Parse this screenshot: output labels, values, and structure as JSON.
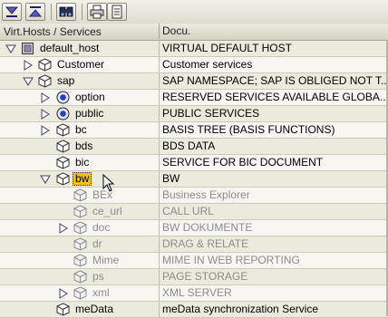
{
  "header": {
    "col1": "Virt.Hosts / Services",
    "col2": "Docu."
  },
  "rows": [
    {
      "name": "default_host",
      "docu": "VIRTUAL DEFAULT HOST"
    },
    {
      "name": "Customer",
      "docu": "Customer services"
    },
    {
      "name": "sap",
      "docu": "SAP NAMESPACE; SAP IS OBLIGED NOT T..."
    },
    {
      "name": "option",
      "docu": "RESERVED SERVICES AVAILABLE GLOBA..."
    },
    {
      "name": "public",
      "docu": "PUBLIC SERVICES"
    },
    {
      "name": "bc",
      "docu": "BASIS TREE (BASIS FUNCTIONS)"
    },
    {
      "name": "bds",
      "docu": "BDS DATA"
    },
    {
      "name": "bic",
      "docu": "SERVICE FOR BIC DOCUMENT"
    },
    {
      "name": "bw",
      "docu": "BW"
    },
    {
      "name": "BEx",
      "docu": "Business Explorer"
    },
    {
      "name": "ce_url",
      "docu": "CALL URL"
    },
    {
      "name": "doc",
      "docu": "BW DOKUMENTE"
    },
    {
      "name": "dr",
      "docu": "DRAG & RELATE"
    },
    {
      "name": "Mime",
      "docu": "MIME IN WEB REPORTING"
    },
    {
      "name": "ps",
      "docu": "PAGE STORAGE"
    },
    {
      "name": "xml",
      "docu": "XML SERVER"
    },
    {
      "name": "meData",
      "docu": "meData synchronization Service"
    }
  ]
}
